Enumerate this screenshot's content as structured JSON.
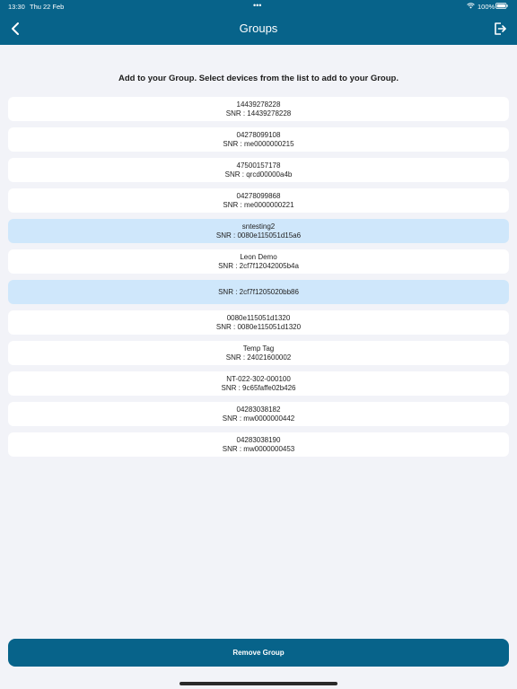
{
  "status_bar": {
    "time": "13:30",
    "date": "Thu 22 Feb",
    "dots": "•••",
    "battery": "100%"
  },
  "nav": {
    "title": "Groups",
    "back_icon": "chevron-left-icon",
    "logout_icon": "logout-icon"
  },
  "instruction": "Add to your Group. Select devices from the list to add to your Group.",
  "devices": [
    {
      "name": "14439278228",
      "snr": "SNR : 14439278228",
      "selected": false
    },
    {
      "name": "04278099108",
      "snr": "SNR : me0000000215",
      "selected": false
    },
    {
      "name": "47500157178",
      "snr": "SNR : qrcd00000a4b",
      "selected": false
    },
    {
      "name": "04278099868",
      "snr": "SNR : me0000000221",
      "selected": false
    },
    {
      "name": "sntesting2",
      "snr": "SNR : 0080e115051d15a6",
      "selected": true
    },
    {
      "name": "Leon Demo",
      "snr": "SNR : 2cf7f12042005b4a",
      "selected": false
    },
    {
      "name": "",
      "snr": "SNR : 2cf7f1205020bb86",
      "selected": true
    },
    {
      "name": "0080e115051d1320",
      "snr": "SNR : 0080e115051d1320",
      "selected": false
    },
    {
      "name": "Temp Tag",
      "snr": "SNR : 24021600002",
      "selected": false
    },
    {
      "name": "NT-022-302-000100",
      "snr": "SNR : 9c65faffe02b426",
      "selected": false
    },
    {
      "name": "04283038182",
      "snr": "SNR : mw0000000442",
      "selected": false
    },
    {
      "name": "04283038190",
      "snr": "SNR : mw0000000453",
      "selected": false
    }
  ],
  "remove_button": "Remove Group",
  "colors": {
    "primary": "#07638a",
    "background": "#f2f3f8",
    "selected_item": "#cfe7fb",
    "item": "#ffffff"
  }
}
